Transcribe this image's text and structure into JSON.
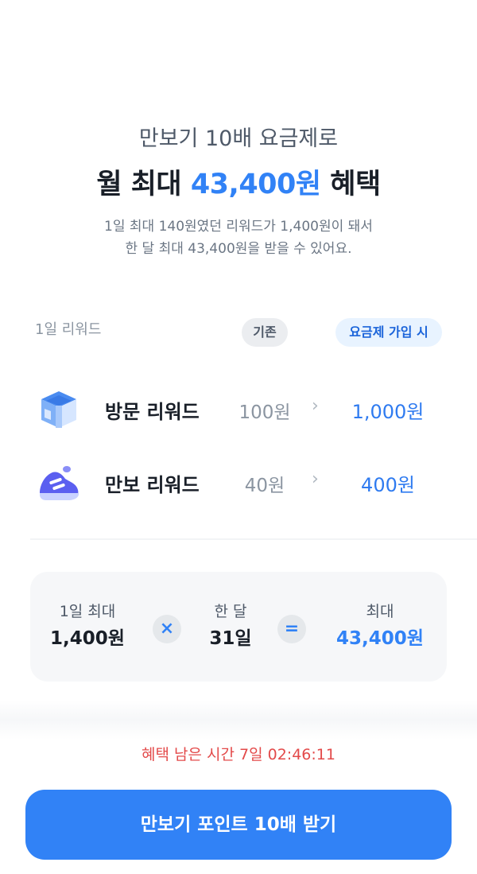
{
  "header": {
    "subtitle": "만보기 10배 요금제로",
    "headline_prefix": "월 최대 ",
    "headline_amount": "43,400원",
    "headline_suffix": " 혜택",
    "desc_line1": "1일 최대 140원였던 리워드가 1,400원이 돼서",
    "desc_line2": "한 달 최대 43,400원을 받을 수 있어요."
  },
  "rewards": {
    "column_label": "1일 리워드",
    "before_label": "기존",
    "after_label": "요금제 가입 시",
    "chevron": "›",
    "items": [
      {
        "icon": "gift-box-icon",
        "label": "방문 리워드",
        "before": "100원",
        "after": "1,000원"
      },
      {
        "icon": "sneaker-icon",
        "label": "만보 리워드",
        "before": "40원",
        "after": "400원"
      }
    ]
  },
  "calc": {
    "daily_label": "1일 최대",
    "daily_value": "1,400원",
    "times_symbol": "×",
    "days_label": "한 달",
    "days_value": "31일",
    "equals_symbol": "=",
    "total_label": "최대",
    "total_value": "43,400원"
  },
  "timer": {
    "text": "혜택 남은 시간 7일 02:46:11"
  },
  "cta": {
    "label": "만보기 포인트 10배 받기"
  },
  "colors": {
    "accent": "#3182f6",
    "timer": "#e34a4a"
  }
}
